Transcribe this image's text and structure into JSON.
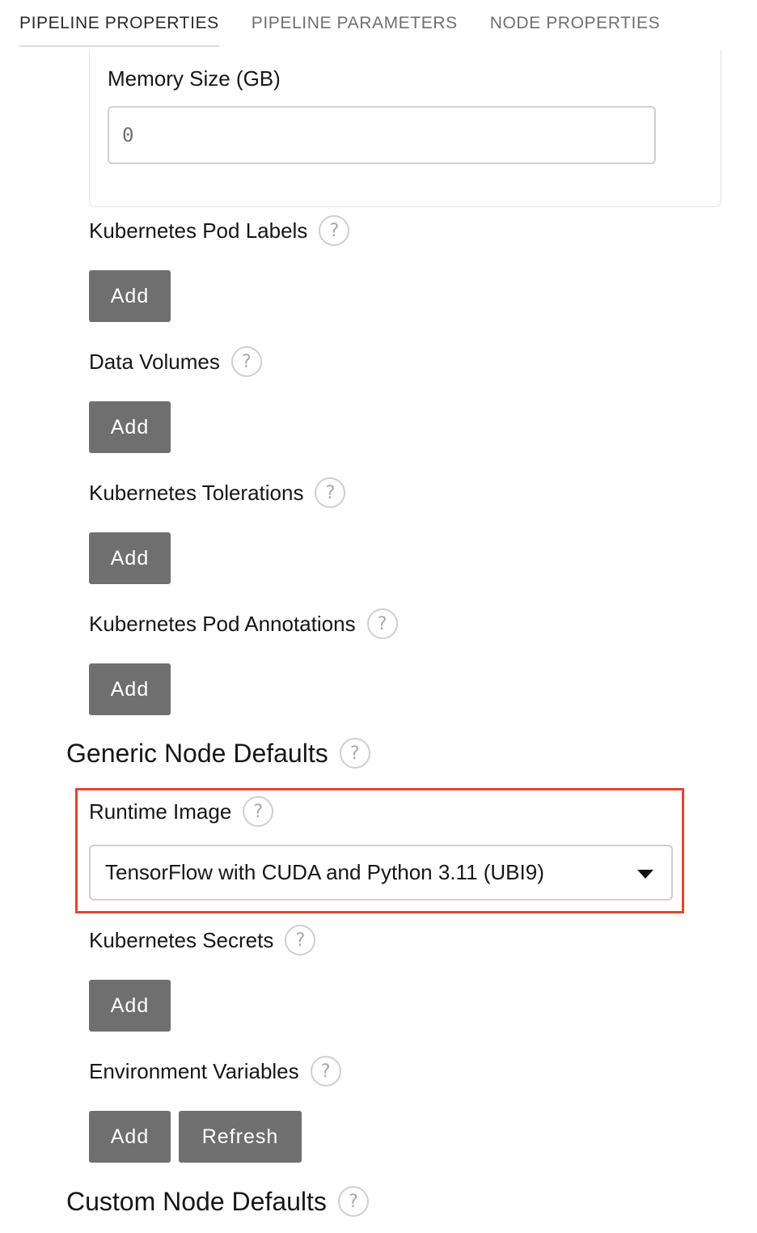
{
  "tabs": [
    {
      "label": "PIPELINE PROPERTIES",
      "active": true
    },
    {
      "label": "PIPELINE PARAMETERS",
      "active": false
    },
    {
      "label": "NODE PROPERTIES",
      "active": false
    }
  ],
  "memory": {
    "label": "Memory Size (GB)",
    "value": "0"
  },
  "fields": {
    "pod_labels": {
      "label": "Kubernetes Pod Labels",
      "button": "Add"
    },
    "data_volumes": {
      "label": "Data Volumes",
      "button": "Add"
    },
    "tolerations": {
      "label": "Kubernetes Tolerations",
      "button": "Add"
    },
    "pod_annotations": {
      "label": "Kubernetes Pod Annotations",
      "button": "Add"
    }
  },
  "generic_defaults": {
    "title": "Generic Node Defaults",
    "runtime_image": {
      "label": "Runtime Image",
      "selected": "TensorFlow with CUDA and Python 3.11 (UBI9)"
    },
    "secrets": {
      "label": "Kubernetes Secrets",
      "button": "Add"
    },
    "env_vars": {
      "label": "Environment Variables",
      "add_button": "Add",
      "refresh_button": "Refresh"
    }
  },
  "custom_defaults": {
    "title": "Custom Node Defaults"
  },
  "help_glyph": "?",
  "colors": {
    "button_bg": "#6f6f6f",
    "highlight_border": "#e2452f"
  }
}
